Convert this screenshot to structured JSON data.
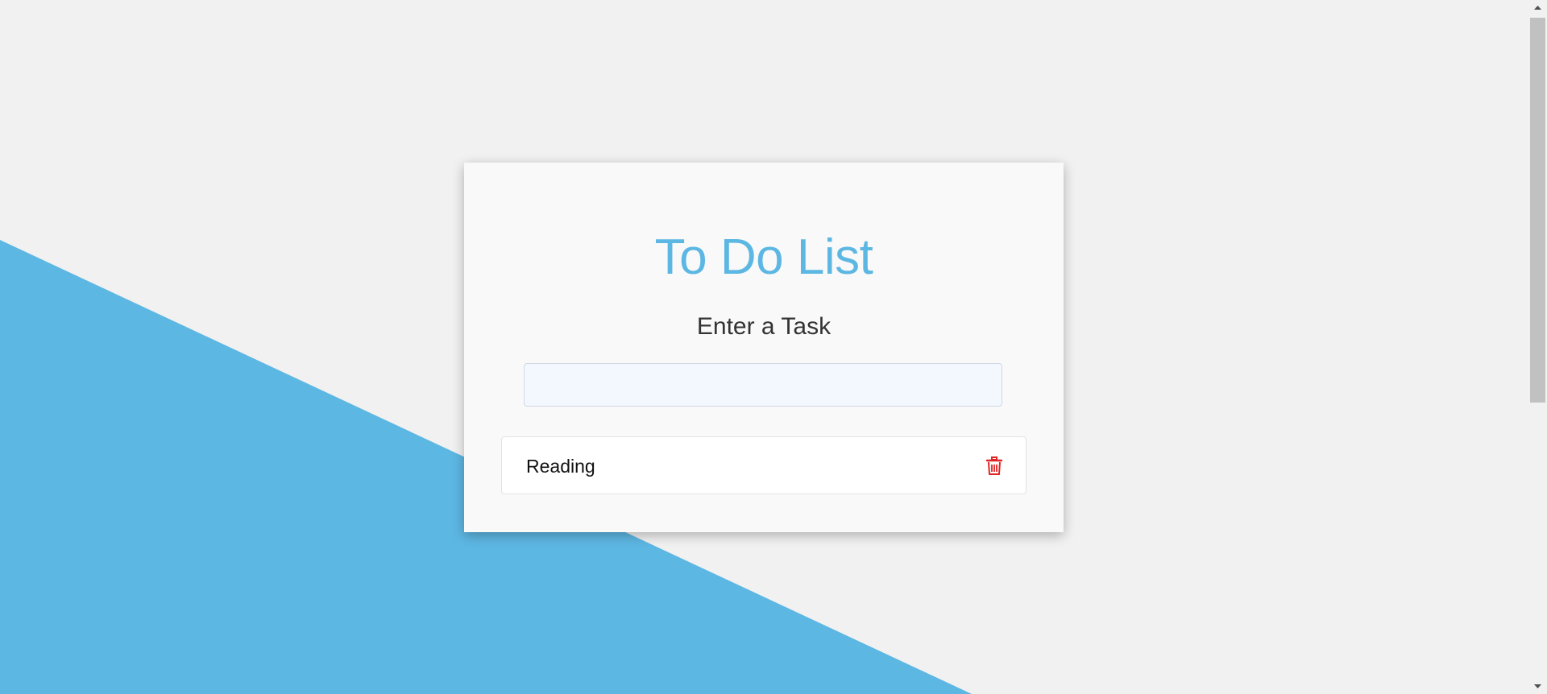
{
  "colors": {
    "background": "#f1f1f1",
    "accent_blue": "#5db7e3",
    "delete_red": "#e02424"
  },
  "app": {
    "title": "To Do List",
    "subtitle": "Enter a Task"
  },
  "task_input": {
    "value": "",
    "placeholder": ""
  },
  "tasks": [
    {
      "text": "Reading",
      "action_icon": "trash-icon"
    }
  ],
  "scrollbar": {
    "up_icon": "arrow-up-icon",
    "down_icon": "arrow-down-icon"
  }
}
